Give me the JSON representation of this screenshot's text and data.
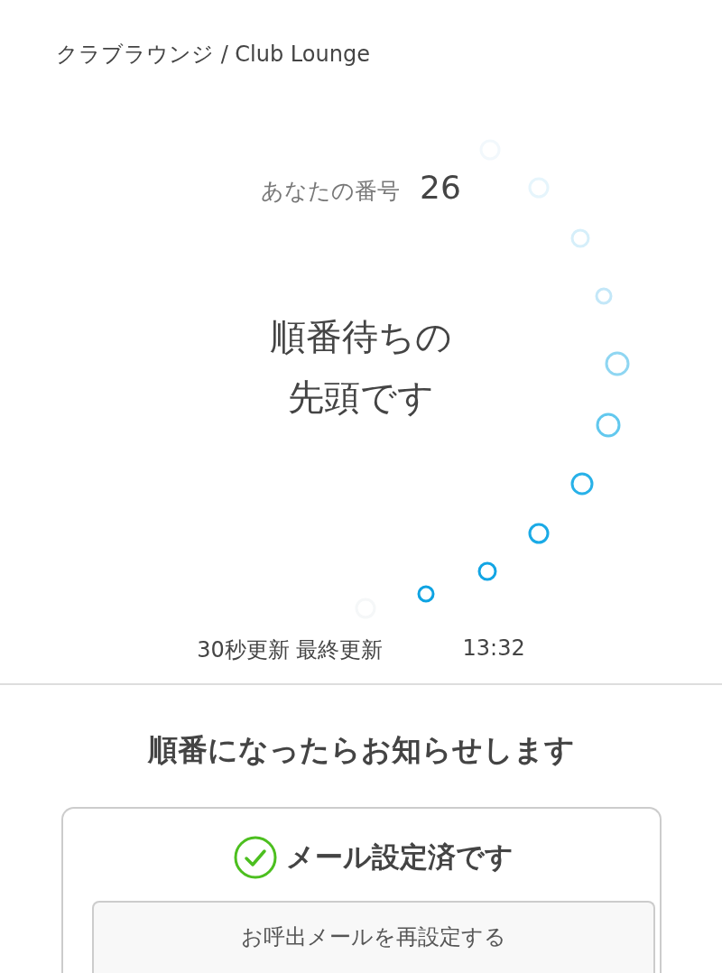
{
  "header": {
    "title": "クラブラウンジ / Club Lounge"
  },
  "ticket": {
    "label": "あなたの番号",
    "number": "26",
    "status_lines": [
      "順番待ちの",
      "先頭です"
    ]
  },
  "update": {
    "interval": "30秒更新 最終更新",
    "time": "13:32"
  },
  "notify": {
    "heading": "順番になったらお知らせします",
    "mail_status": "メール設定済です",
    "mail_set": true,
    "reset_button": "お呼出メールを再設定する"
  }
}
